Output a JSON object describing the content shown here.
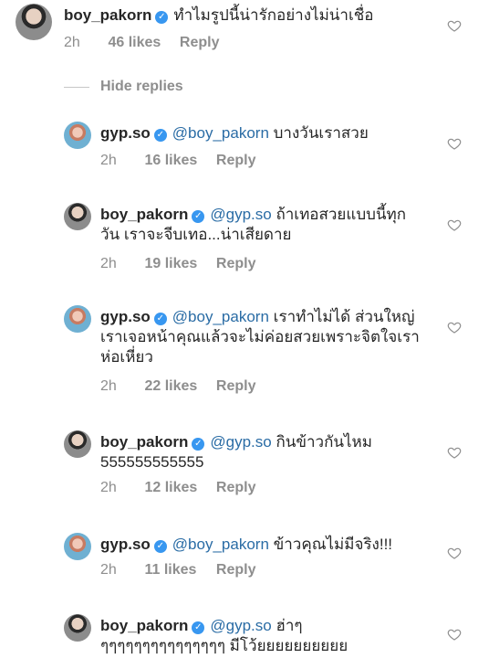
{
  "main_comment": {
    "username": "boy_pakorn",
    "text": "ทำไมรูปนี้น่ารักอย่างไม่น่าเชื่อ",
    "time": "2h",
    "likes": "46 likes",
    "reply": "Reply"
  },
  "hide_replies_label": "Hide replies",
  "replies": [
    {
      "username": "gyp.so",
      "mention": "@boy_pakorn",
      "text": " บางวันเราสวย",
      "time": "2h",
      "likes": "16 likes",
      "reply": "Reply"
    },
    {
      "username": "boy_pakorn",
      "mention": "@gyp.so",
      "text": " ถ้าเทอสวยแบบนี้ทุกวัน เราจะจีบเทอ...น่าเสียดาย",
      "time": "2h",
      "likes": "19 likes",
      "reply": "Reply"
    },
    {
      "username": "gyp.so",
      "mention": "@boy_pakorn",
      "text": " เราทำไม่ได้ ส่วนใหญ่เราเจอหน้าคุณแล้วจะไม่ค่อยสวยเพราะจิตใจเราห่อเหี่ยว",
      "time": "2h",
      "likes": "22 likes",
      "reply": "Reply"
    },
    {
      "username": "boy_pakorn",
      "mention": "@gyp.so",
      "text": " กินข้าวกันไหม 555555555555",
      "time": "2h",
      "likes": "12 likes",
      "reply": "Reply"
    },
    {
      "username": "gyp.so",
      "mention": "@boy_pakorn",
      "text": " ข้าวคุณไม่มีจริง!!!",
      "time": "2h",
      "likes": "11 likes",
      "reply": "Reply"
    },
    {
      "username": "boy_pakorn",
      "mention": "@gyp.so",
      "text": " ฮ่าๆๆๆๆๆๆๆๆๆๆๆๆๆๆๆๆ มีโว้ยยยยยยยยยย",
      "time": "",
      "likes": "",
      "reply": ""
    }
  ],
  "icons": {
    "verified": "verified-badge-icon",
    "like": "heart-outline-icon"
  },
  "colors": {
    "mention": "#2a6ca5",
    "verified": "#3897f0",
    "meta": "#8e8e8e"
  }
}
